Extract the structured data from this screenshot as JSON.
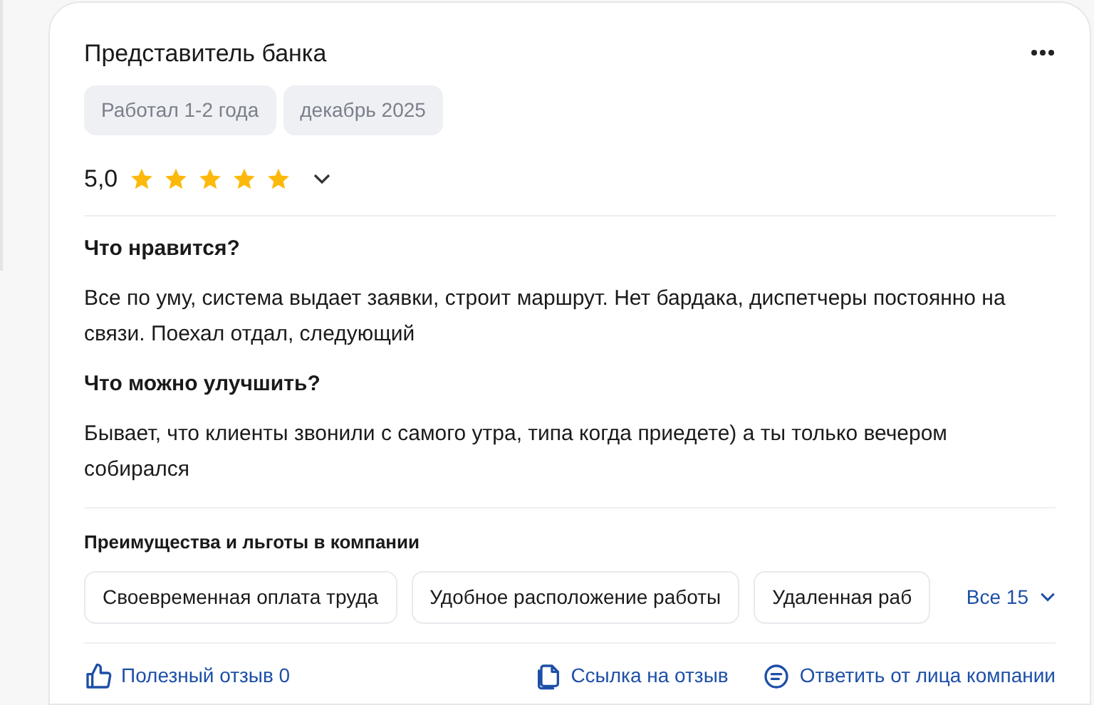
{
  "review": {
    "title": "Представитель банка",
    "tags": [
      "Работал 1-2 года",
      "декабрь 2025"
    ],
    "rating": "5,0",
    "stars": 5,
    "sections": [
      {
        "heading": "Что нравится?",
        "text": "Все по уму, система выдает заявки, строит маршрут. Нет бардака, диспетчеры постоянно на связи. Поехал отдал, следующий"
      },
      {
        "heading": "Что можно улучшить?",
        "text": "Бывает, что клиенты звонили с самого утра, типа когда приедете) а ты только вечером собирался"
      }
    ],
    "benefits": {
      "heading": "Преимущества и льготы в компании",
      "chips": [
        "Своевременная оплата труда",
        "Удобное расположение работы",
        "Удаленная раб"
      ],
      "more": "Все 15"
    },
    "actions": [
      {
        "kind": "like",
        "label": "Полезный отзыв 0"
      },
      {
        "kind": "link",
        "label": "Ссылка на отзыв"
      },
      {
        "kind": "reply",
        "label": "Ответить от лица компании"
      }
    ]
  }
}
